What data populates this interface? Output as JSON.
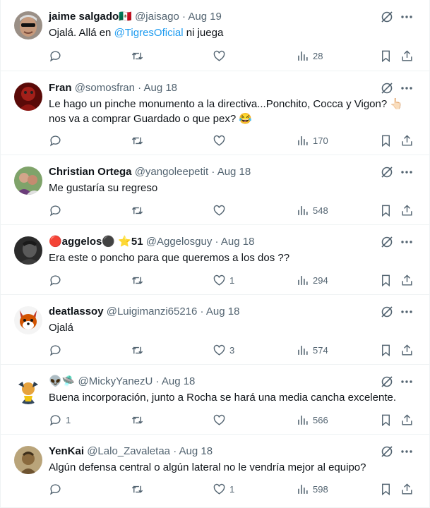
{
  "replies": [
    {
      "name": "jaime salgado🇲🇽",
      "handle": "@jaisago",
      "dot": "·",
      "time": "Aug 19",
      "text_before": "Ojalá. Allá en ",
      "mention": "@TigresOficial",
      "text_after": " ni juega",
      "reply_count": "",
      "retweet_count": "",
      "like_count": "",
      "views": "28"
    },
    {
      "name": "Fran",
      "handle": "@somosfran",
      "dot": "·",
      "time": "Aug 18",
      "text": "Le hago un pinche monumento a la directiva...Ponchito, Cocca y Vigon? 👆🏻 nos va a comprar Guardado o que pex? 😂",
      "reply_count": "",
      "retweet_count": "",
      "like_count": "",
      "views": "170"
    },
    {
      "name": "Christian Ortega",
      "handle": "@yangoleepetit",
      "dot": "·",
      "time": "Aug 18",
      "text": "Me gustaría su regreso",
      "reply_count": "",
      "retweet_count": "",
      "like_count": "",
      "views": "548"
    },
    {
      "name": "🔴aggelos⚫ ⭐51",
      "handle": "@Aggelosguy",
      "dot": "·",
      "time": "Aug 18",
      "text": "Era este o poncho para que queremos a los dos ??",
      "reply_count": "",
      "retweet_count": "",
      "like_count": "1",
      "views": "294"
    },
    {
      "name": "deatlassoy",
      "handle": "@Luigimanzi65216",
      "dot": "·",
      "time": "Aug 18",
      "text": "Ojalá",
      "reply_count": "",
      "retweet_count": "",
      "like_count": "3",
      "views": "574"
    },
    {
      "name": "👽🛸",
      "handle": "@MickyYanezU",
      "dot": "·",
      "time": "Aug 18",
      "text": "Buena incorporación, junto a Rocha se hará una media cancha excelente.",
      "reply_count": "1",
      "retweet_count": "",
      "like_count": "",
      "views": "566"
    },
    {
      "name": "YenKai",
      "handle": "@Lalo_Zavaletaa",
      "dot": "·",
      "time": "Aug 18",
      "text": "Algún defensa central o algún lateral no le vendría mejor al equipo?",
      "reply_count": "",
      "retweet_count": "",
      "like_count": "1",
      "views": "598"
    }
  ],
  "icons": {
    "reply": "reply-icon",
    "retweet": "retweet-icon",
    "like": "like-icon",
    "views": "views-icon",
    "bookmark": "bookmark-icon",
    "share": "share-icon",
    "grok": "grok-icon",
    "more": "more-icon"
  },
  "colors": {
    "text": "#0f1419",
    "secondary": "#536471",
    "link": "#1d9bf0",
    "divider": "#eff3f4"
  }
}
